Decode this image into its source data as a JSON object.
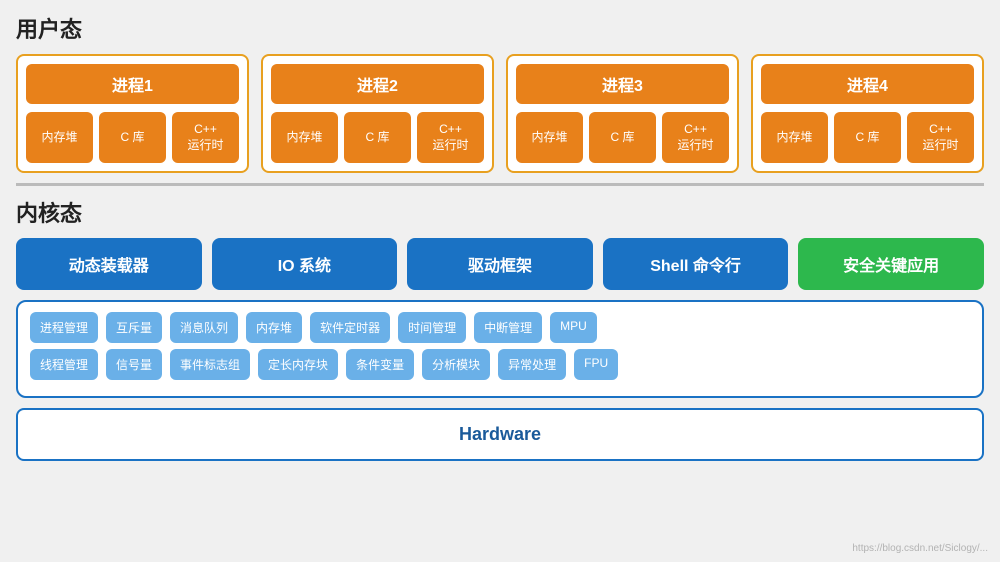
{
  "userSpace": {
    "title": "用户态",
    "processes": [
      {
        "name": "进程1",
        "items": [
          "内存堆",
          "C 库",
          "C++\n运行时"
        ]
      },
      {
        "name": "进程2",
        "items": [
          "内存堆",
          "C 库",
          "C++\n运行时"
        ]
      },
      {
        "name": "进程3",
        "items": [
          "内存堆",
          "C 库",
          "C++\n运行时"
        ]
      },
      {
        "name": "进程4",
        "items": [
          "内存堆",
          "C 库",
          "C++\n运行时"
        ]
      }
    ]
  },
  "kernelSpace": {
    "title": "内核态",
    "row1": [
      {
        "label": "动态装载器",
        "color": "blue"
      },
      {
        "label": "IO 系统",
        "color": "blue"
      },
      {
        "label": "驱动框架",
        "color": "blue"
      },
      {
        "label": "Shell 命令行",
        "color": "blue"
      },
      {
        "label": "安全关键应用",
        "color": "green"
      }
    ],
    "components": {
      "row1": [
        "进程管理",
        "互斥量",
        "消息队列",
        "内存堆",
        "软件定时器",
        "时间管理",
        "中断管理",
        "MPU"
      ],
      "row2": [
        "线程管理",
        "信号量",
        "事件标志组",
        "定长内存块",
        "条件变量",
        "分析模块",
        "异常处理",
        "FPU"
      ]
    },
    "hardware": "Hardware"
  },
  "watermark": "https://blog.csdn.net/Siclogy/..."
}
